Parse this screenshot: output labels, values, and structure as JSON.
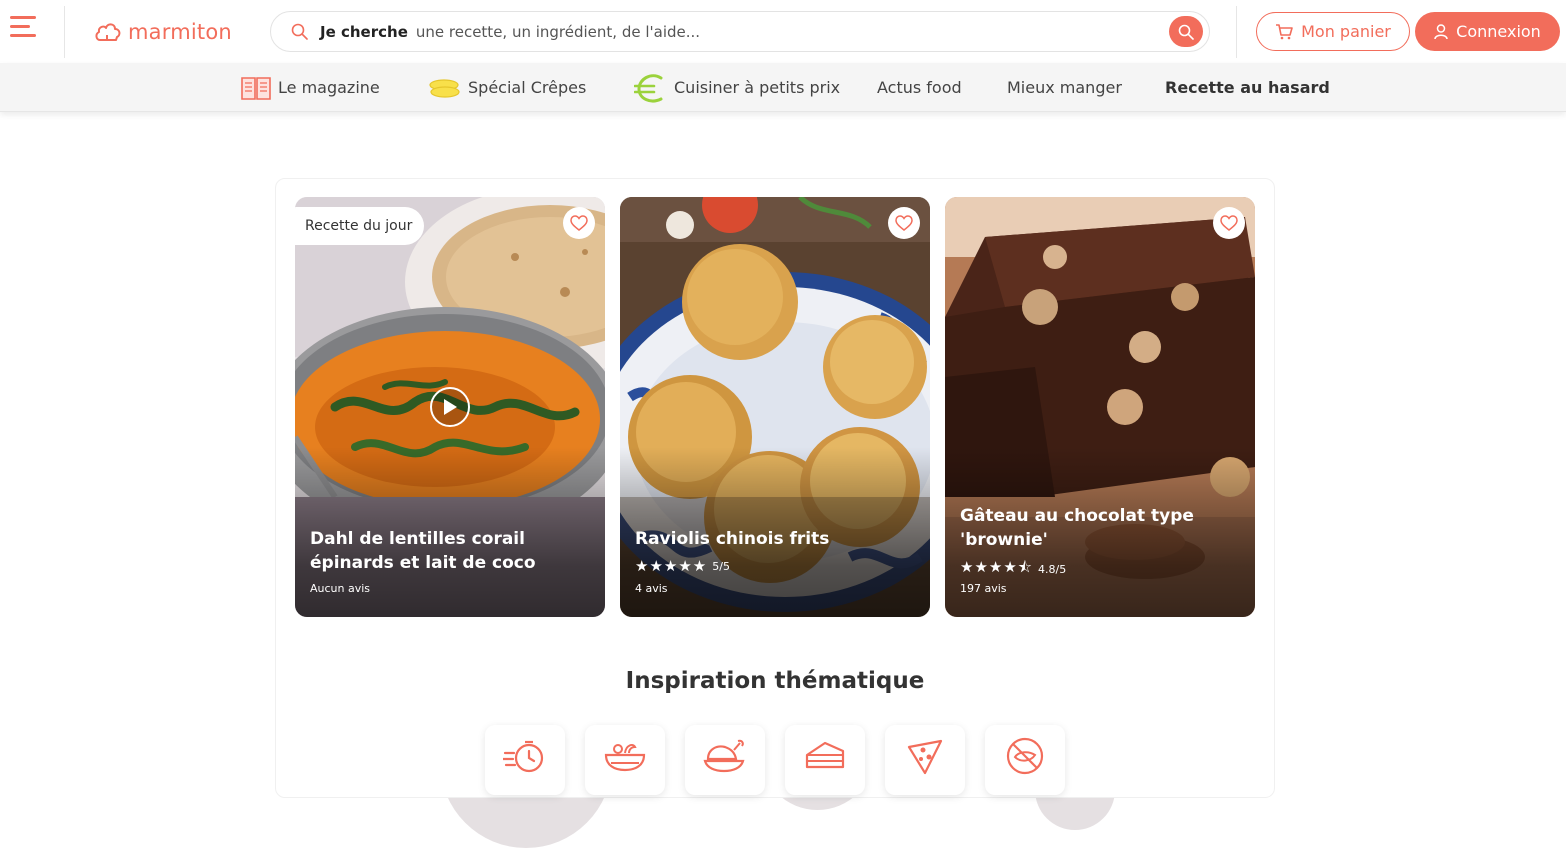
{
  "header": {
    "logo_text": "marmiton",
    "search": {
      "prefix": "Je cherche",
      "placeholder": "une recette, un ingrédient, de l'aide..."
    },
    "cart_label": "Mon panier",
    "login_label": "Connexion"
  },
  "nav": {
    "items": [
      {
        "label": "Le magazine",
        "icon": "book-icon"
      },
      {
        "label": "Spécial Crêpes",
        "icon": "crepes-icon"
      },
      {
        "label": "Cuisiner à petits prix",
        "icon": "euro-icon"
      },
      {
        "label": "Actus food"
      },
      {
        "label": "Mieux manger"
      },
      {
        "label": "Recette au hasard"
      }
    ]
  },
  "recipes": [
    {
      "badge": "Recette du jour",
      "title": "Dahl de lentilles corail épinards et lait de coco",
      "reviews": "Aucun avis",
      "has_video": true
    },
    {
      "title": "Raviolis chinois frits",
      "rating": "5/5",
      "rating_value": 5,
      "reviews": "4 avis"
    },
    {
      "title": "Gâteau au chocolat type 'brownie'",
      "rating": "4.8/5",
      "rating_value": 4.8,
      "reviews": "197 avis"
    }
  ],
  "inspiration": {
    "title": "Inspiration thématique",
    "icons": [
      "quick-timer-icon",
      "salad-bowl-icon",
      "roast-chicken-icon",
      "cake-slice-icon",
      "pizza-slice-icon",
      "no-allergen-icon"
    ]
  },
  "colors": {
    "accent": "#f26d5b",
    "nav_bg": "#f5f5f5"
  }
}
